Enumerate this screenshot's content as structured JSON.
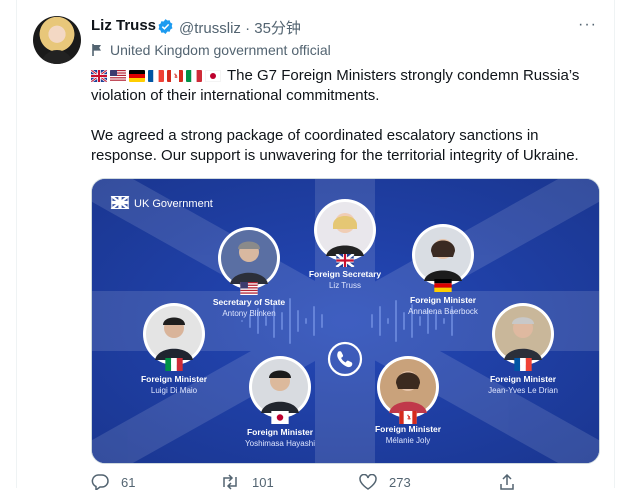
{
  "author": {
    "name": "Liz Truss",
    "handle": "@trussliz",
    "separator": "·",
    "time": "35分钟",
    "label": "United Kingdom government official"
  },
  "tweet": {
    "flag_names": [
      "United Kingdom",
      "United States",
      "Germany",
      "France",
      "Canada",
      "Italy",
      "Japan"
    ],
    "line1": "The G7 Foreign Ministers strongly condemn Russia’s violation of their international commitments.",
    "line2": "We agreed a strong package of coordinated escalatory sanctions in response. Our support is unwavering for the territorial integrity of Ukraine."
  },
  "media": {
    "brand": "UK Government",
    "background_color": "#1f3fa3",
    "people": [
      {
        "role": "Foreign Secretary",
        "name": "Liz Truss",
        "flag": "United Kingdom"
      },
      {
        "role": "Secretary of State",
        "name": "Antony Blinken",
        "flag": "United States"
      },
      {
        "role": "Foreign Minister",
        "name": "Annalena Baerbock",
        "flag": "Germany"
      },
      {
        "role": "Foreign Minister",
        "name": "Luigi Di Maio",
        "flag": "Italy"
      },
      {
        "role": "Foreign Minister",
        "name": "Jean-Yves Le Drian",
        "flag": "France"
      },
      {
        "role": "Foreign Minister",
        "name": "Yoshimasa Hayashi",
        "flag": "Japan"
      },
      {
        "role": "Foreign Minister",
        "name": "Mélanie Joly",
        "flag": "Canada"
      }
    ],
    "center_icon": "phone-icon"
  },
  "actions": {
    "reply_count": "61",
    "retweet_count": "101",
    "like_count": "273"
  },
  "colors": {
    "accent": "#1d9bf0",
    "muted": "#536471"
  }
}
